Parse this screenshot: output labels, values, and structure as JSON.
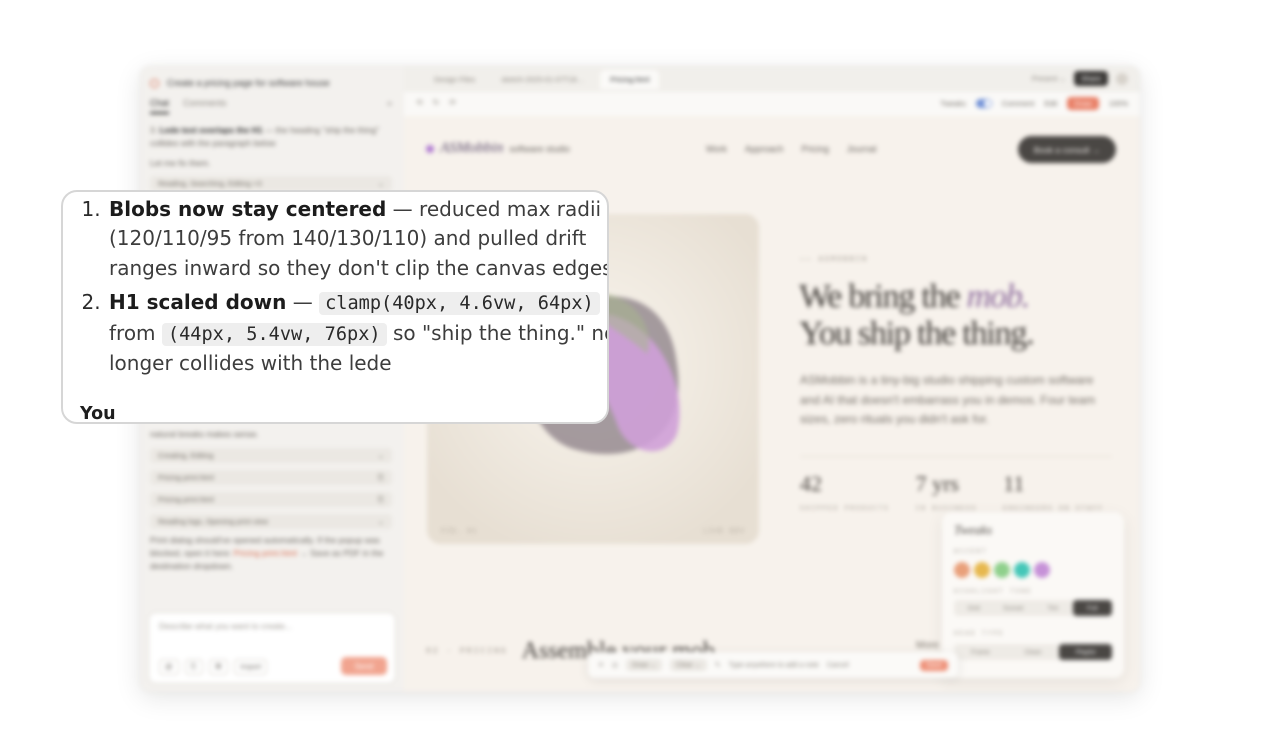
{
  "zoom": {
    "items": [
      {
        "title": "Blobs now stay centered",
        "dash": " — ",
        "body": "reduced max radii (120/110/95 from 140/130/110) and pulled drift ranges inward so they don't clip the canvas edges"
      },
      {
        "title": "H1 scaled down",
        "dash": " — ",
        "code_new": "clamp(40px, 4.6vw, 64px)",
        "from_word": " from ",
        "code_old": "(44px, 5.4vw, 76px)",
        "body_tail": " so \"ship the thing.\" no longer collides with the lede"
      }
    ],
    "you_label": "You"
  },
  "window": {
    "project_title": "Create a pricing page for software house",
    "panel_tabs": [
      "Chat",
      "Comments"
    ],
    "panel_close": "»",
    "chat": {
      "issue_num": "3.",
      "issue_title": "Lede text overlaps the H1",
      "issue_body": " — the heading \"ship the thing\" collides with the paragraph below",
      "fix_line": "Let me fix them.",
      "tool_top": "Reading, Searching, Editing ×3",
      "natural": "natural breaks makes sense.",
      "tool_rows": [
        "Creating, Editing",
        "Pricing print.html",
        "Pricing print.html",
        "Reading logs, Opening print view"
      ],
      "print_note_a": "Print dialog should've opened automatically. If the popup was blocked, open it here: ",
      "print_link": "Pricing print.html",
      "print_note_b": " → Save as PDF in the destination dropdown.",
      "composer_placeholder": "Describe what you want to create...",
      "composer_buttons": [
        "@",
        "⎘",
        "⌘",
        "Import"
      ],
      "send_label": "Send"
    },
    "file_tabs": [
      "Design Files",
      "sketch-2025-01-07T18…",
      "Pricing.html"
    ],
    "present_label": "Present ⌄",
    "share_label": "Share",
    "toolbar_left": [
      "⟲",
      "↻",
      "⟳"
    ],
    "tweaks_label": "Tweaks",
    "comment_label": "Comment",
    "edit_label": "Edit",
    "draw_label": "Draw",
    "zoom_label": "100%"
  },
  "site": {
    "brand_name": "ASMobbin",
    "brand_sub": "software studio",
    "nav": [
      "Work",
      "Approach",
      "Pricing",
      "Journal"
    ],
    "cta": "Book a consult →",
    "hero_meta_left": "FIG. 01",
    "hero_meta_right": "LIVE DEV",
    "eyebrow": "—— ASMOBBIN",
    "h1_line1_a": "We bring the ",
    "h1_line1_b": "mob.",
    "h1_line2": "You ship the thing.",
    "lede": "ASMobbin is a tiny-big studio shipping custom software and AI that doesn't embarrass you in demos. Four team sizes, zero rituals you didn't ask for.",
    "stats": [
      {
        "value": "42",
        "label": "SHIPPED PRODUCTS"
      },
      {
        "value": "7 yrs",
        "label": "IN BUSINESS"
      },
      {
        "value": "11",
        "label": "ENGINEERS ON STAFF"
      }
    ],
    "section_num": "02 · PRICING",
    "section_title": "Assemble your mob",
    "more_label": "More"
  },
  "tweaks_panel": {
    "title": "Tweaks",
    "accent_label": "ACCENT",
    "accent_colors": [
      "#e9a07a",
      "#e7b84e",
      "#8fd08c",
      "#45c7b8",
      "#c691d8"
    ],
    "highlight_label": "HIGHLIGHT TONE",
    "highlight_options": [
      "Grid",
      "Sunset",
      "Tint",
      "Full"
    ],
    "highlight_selected": "Full",
    "type_label": "HEAD TYPE",
    "type_options": [
      "Frame",
      "Clean",
      "Playful"
    ],
    "type_selected": "Playful"
  },
  "bottom_bar": {
    "chips": [
      "Draw ⌄",
      "Clear ⌄"
    ],
    "note_placeholder": "Type anywhere to add a note",
    "cancel": "Cancel",
    "save": "Save"
  }
}
